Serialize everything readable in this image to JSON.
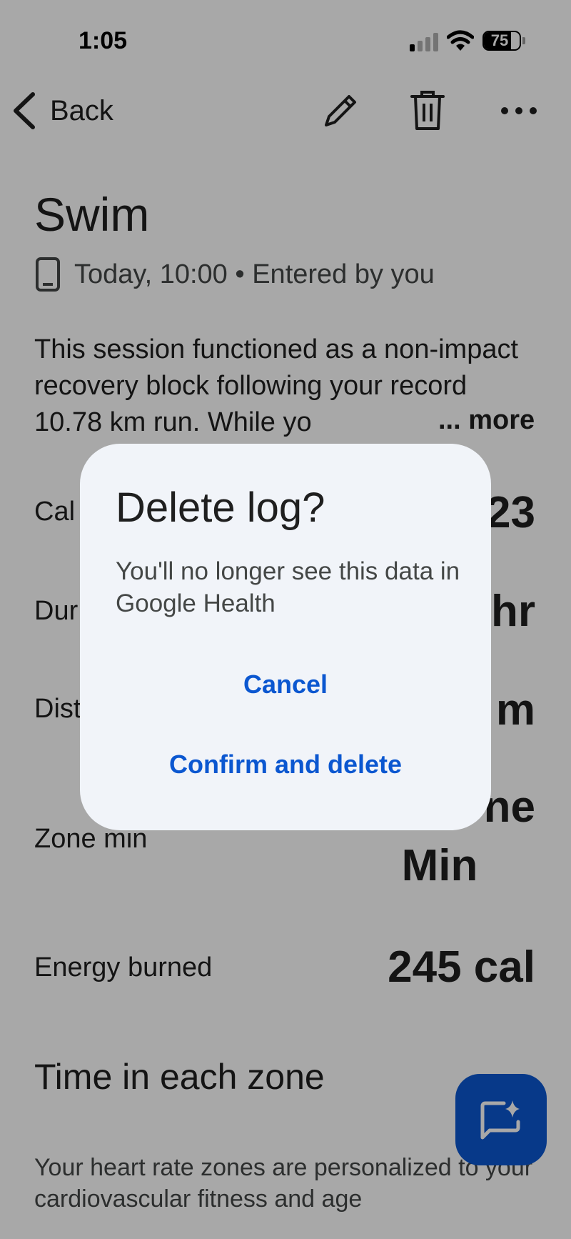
{
  "status_bar": {
    "time": "1:05",
    "battery": "75",
    "battery_level_percent": 75,
    "signal_bars_active": 1,
    "signal_bars_total": 4
  },
  "app_bar": {
    "back_label": "Back",
    "icons": [
      "back-chevron-icon",
      "pencil-icon",
      "trash-icon",
      "more-horizontal-icon"
    ]
  },
  "session": {
    "title": "Swim",
    "meta": "Today, 10:00 • Entered by you",
    "description": "This session functioned as a non-impact recovery block following your record 10.78 km run. While yo",
    "more_label": "... more"
  },
  "stats": {
    "calories_label": "Cal",
    "calories_value": "23",
    "duration_label": "Dur",
    "duration_value": "hr",
    "distance_label": "Dist",
    "distance_value": "m",
    "zone_label": "Zone min",
    "zone_value_line1": "ne",
    "zone_value_line2": "Min",
    "energy_label": "Energy burned",
    "energy_value": "245 cal"
  },
  "zones_section": {
    "title": "Time in each zone",
    "description": "Your heart rate zones are personalized to your cardiovascular fitness and age"
  },
  "fab": {
    "icon": "chat-sparkle-icon"
  },
  "dialog": {
    "title": "Delete log?",
    "body": "You'll no longer see this data in Google Health",
    "cancel_label": "Cancel",
    "confirm_label": "Confirm and delete"
  },
  "colors": {
    "accent": "#0b57d0",
    "text_primary": "#1f1f1f",
    "text_secondary": "#444746",
    "dialog_surface": "#f1f4f9",
    "scrim": "rgba(0,0,0,0.34)"
  }
}
